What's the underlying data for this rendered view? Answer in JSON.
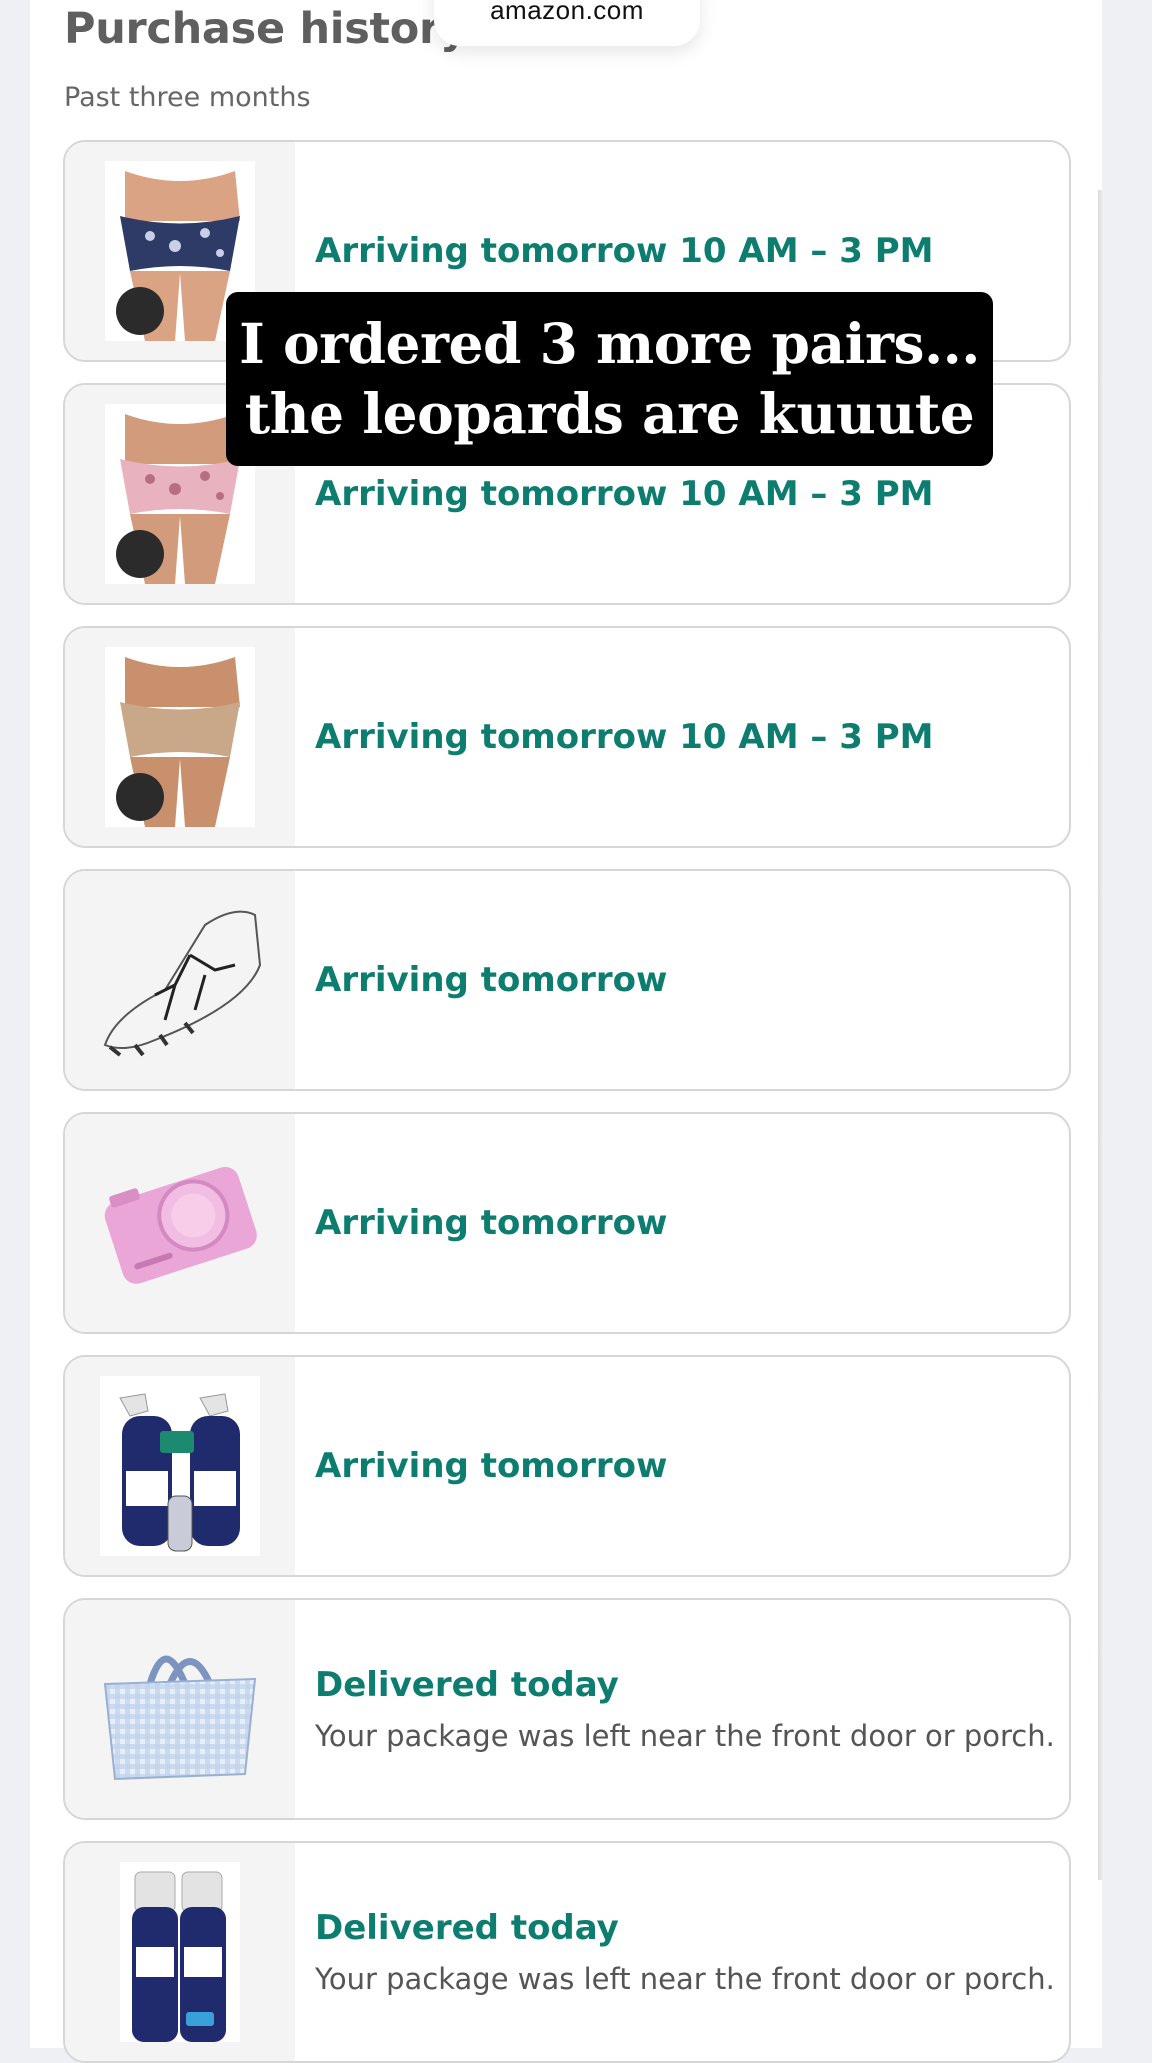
{
  "browser": {
    "url": "amazon.com"
  },
  "page": {
    "title": "Purchase history",
    "subtitle": "Past three months"
  },
  "overlay": {
    "line1": "I ordered 3 more pairs...",
    "line2": "the leopards are kuuute"
  },
  "orders": [
    {
      "product_icon": "blue-leopard-underwear-image",
      "status": "Arriving tomorrow 10 AM – 3 PM",
      "detail": ""
    },
    {
      "product_icon": "pink-leopard-underwear-image",
      "status": "Arriving tomorrow 10 AM – 3 PM",
      "detail": ""
    },
    {
      "product_icon": "nude-underwear-image",
      "status": "Arriving tomorrow 10 AM – 3 PM",
      "detail": ""
    },
    {
      "product_icon": "soccer-cleat-image",
      "status": "Arriving tomorrow",
      "detail": ""
    },
    {
      "product_icon": "pink-camera-case-image",
      "status": "Arriving tomorrow",
      "detail": ""
    },
    {
      "product_icon": "downy-wrinkle-releaser-3pack-image",
      "status": "Arriving tomorrow",
      "detail": ""
    },
    {
      "product_icon": "gingham-tote-bag-image",
      "status": "Delivered today",
      "detail": "Your package was left near the front door or porch."
    },
    {
      "product_icon": "downy-wrinkle-releaser-2pack-image",
      "status": "Delivered today",
      "detail": "Your package was left near the front door or porch."
    }
  ],
  "colors": {
    "status_green": "#0d7d6f",
    "overlay_bg": "#000000"
  }
}
